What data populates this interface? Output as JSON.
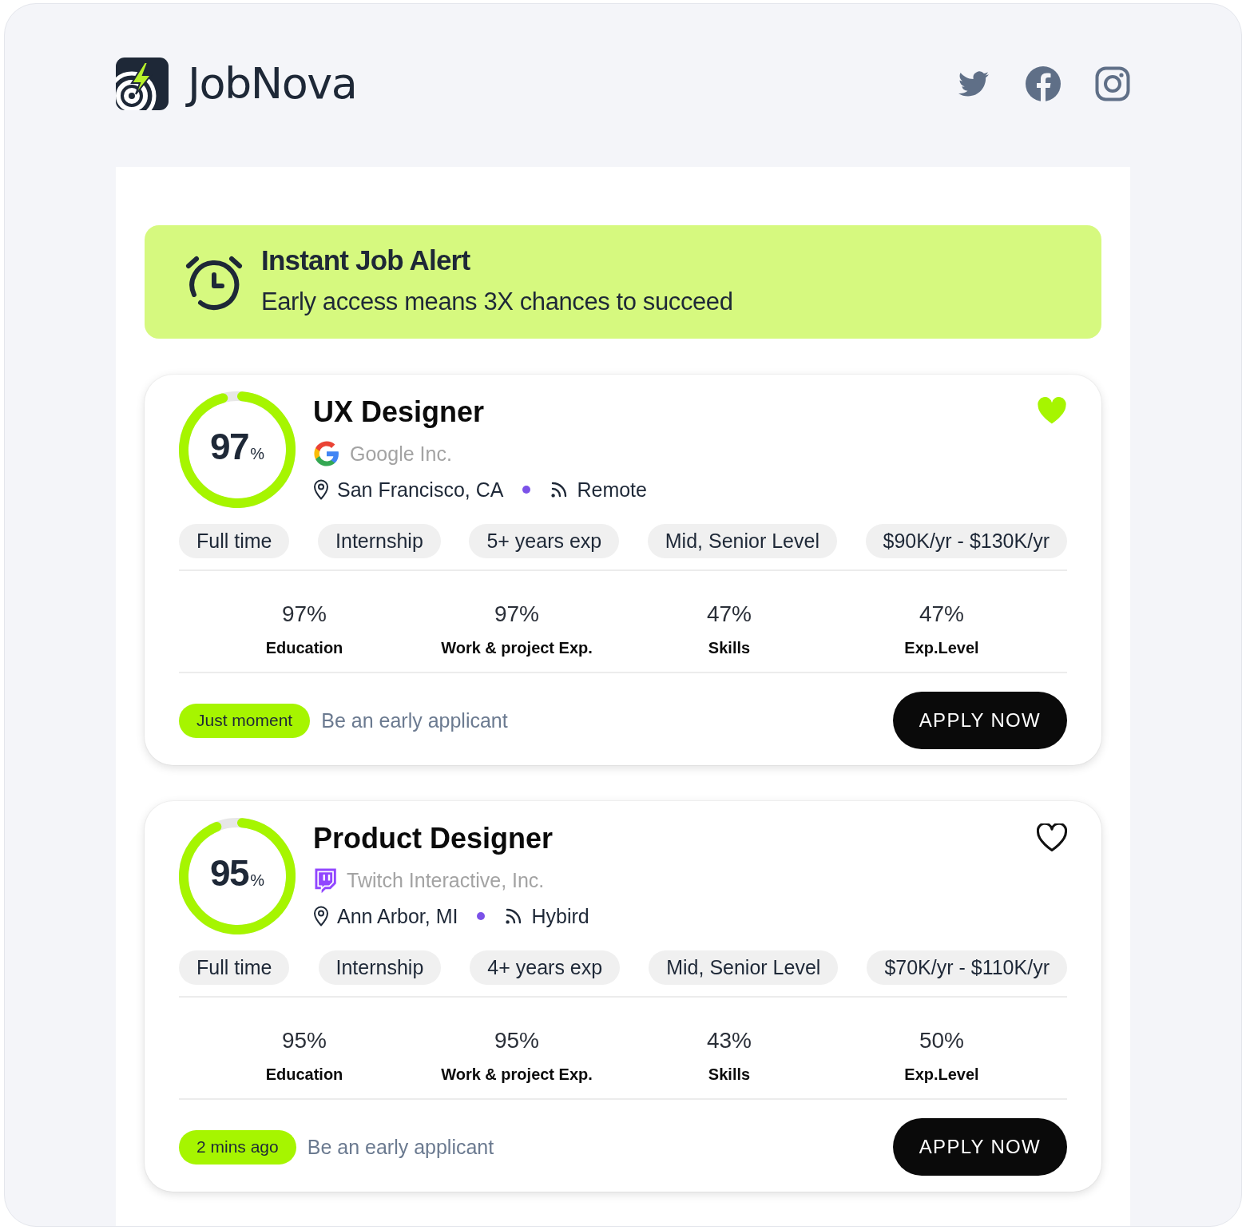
{
  "brand": {
    "name": "JobNova"
  },
  "alert": {
    "title": "Instant Job Alert",
    "subtitle": "Early access means 3X chances to succeed"
  },
  "jobs": [
    {
      "score": "97",
      "score_unit": "%",
      "level": 0.97,
      "title": "UX Designer",
      "favorite": true,
      "company": {
        "kind": "google",
        "name": "Google Inc."
      },
      "location": "San Francisco, CA",
      "work_mode": "Remote",
      "tags": [
        "Full time",
        "Internship",
        "5+ years exp",
        "Mid, Senior Level",
        "$90K/yr - $130K/yr"
      ],
      "stats": [
        {
          "value": "97%",
          "label": "Education"
        },
        {
          "value": "97%",
          "label": "Work & project Exp."
        },
        {
          "value": "47%",
          "label": "Skills"
        },
        {
          "value": "47%",
          "label": "Exp.Level"
        }
      ],
      "posted": "Just moment",
      "note": "Be an early applicant",
      "apply_label": "APPLY NOW"
    },
    {
      "score": "95",
      "score_unit": "%",
      "level": 0.95,
      "title": "Product Designer",
      "favorite": false,
      "company": {
        "kind": "twitch",
        "name": "Twitch Interactive, Inc."
      },
      "location": "Ann Arbor, MI",
      "work_mode": "Hybird",
      "tags": [
        "Full time",
        "Internship",
        "4+ years exp",
        "Mid, Senior Level",
        "$70K/yr - $110K/yr"
      ],
      "stats": [
        {
          "value": "95%",
          "label": "Education"
        },
        {
          "value": "95%",
          "label": "Work & project Exp."
        },
        {
          "value": "43%",
          "label": "Skills"
        },
        {
          "value": "50%",
          "label": "Exp.Level"
        }
      ],
      "posted": "2 mins ago",
      "note": "Be an early applicant",
      "apply_label": "APPLY NOW"
    }
  ]
}
